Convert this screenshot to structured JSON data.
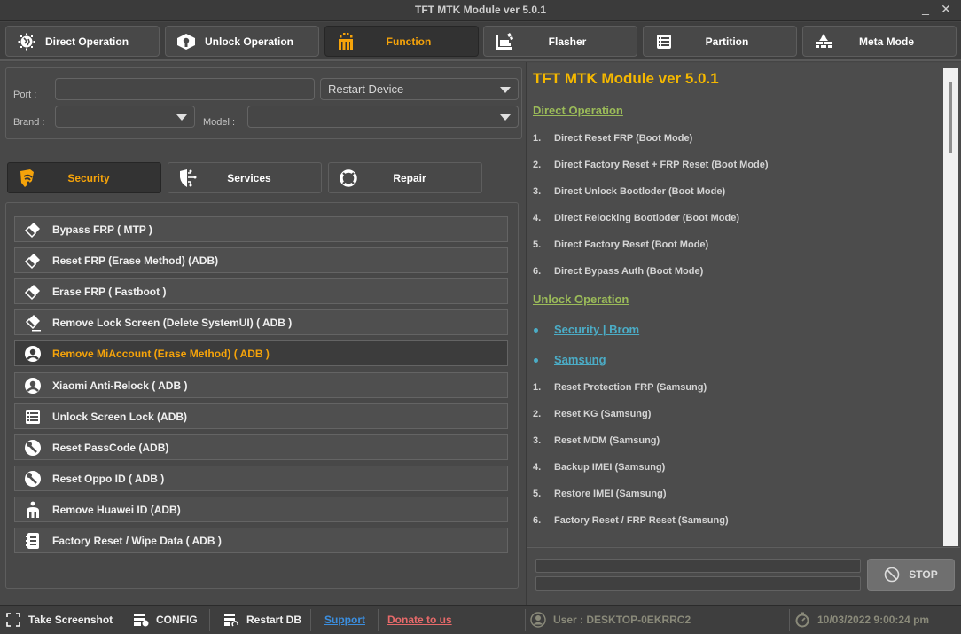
{
  "window": {
    "title": "TFT MTK Module ver 5.0.1",
    "minimize_icon": "minimize-icon",
    "close_icon": "close-icon"
  },
  "topnav": [
    {
      "label": "Direct Operation",
      "icon": "globe-gear-icon",
      "active": false
    },
    {
      "label": "Unlock Operation",
      "icon": "unlock-box-icon",
      "active": false
    },
    {
      "label": "Function",
      "icon": "gift-box-icon",
      "active": true
    },
    {
      "label": "Flasher",
      "icon": "flasher-icon",
      "active": false
    },
    {
      "label": "Partition",
      "icon": "list-icon",
      "active": false
    },
    {
      "label": "Meta Mode",
      "icon": "firewall-icon",
      "active": false
    }
  ],
  "device": {
    "port_label": "Port :",
    "port_value": "",
    "restart_select": "Restart Device",
    "brand_label": "Brand :",
    "brand_value": "",
    "model_label": "Model :",
    "model_value": ""
  },
  "subtabs": [
    {
      "label": "Security",
      "icon": "shield-wifi-icon",
      "active": true
    },
    {
      "label": "Services",
      "icon": "shield-circuit-icon",
      "active": false
    },
    {
      "label": "Repair",
      "icon": "lifebuoy-icon",
      "active": false
    }
  ],
  "functions": [
    {
      "label": "Bypass FRP ( MTP )",
      "icon": "eraser-icon",
      "active": false
    },
    {
      "label": "Reset FRP (Erase Method) (ADB)",
      "icon": "eraser-icon",
      "active": false
    },
    {
      "label": "Erase FRP ( Fastboot )",
      "icon": "eraser-icon",
      "active": false
    },
    {
      "label": "Remove Lock Screen (Delete SystemUI) ( ADB )",
      "icon": "eraser-line-icon",
      "active": false
    },
    {
      "label": "Remove MiAccount (Erase Method) ( ADB )",
      "icon": "user-circle-icon",
      "active": true
    },
    {
      "label": "Xiaomi Anti-Relock ( ADB )",
      "icon": "user-circle-icon",
      "active": false
    },
    {
      "label": "Unlock Screen Lock (ADB)",
      "icon": "list-icon",
      "active": false
    },
    {
      "label": "Reset PassCode (ADB)",
      "icon": "wrench-circle-icon",
      "active": false
    },
    {
      "label": "Reset Oppo ID ( ADB )",
      "icon": "wrench-circle-icon",
      "active": false
    },
    {
      "label": "Remove Huawei ID (ADB)",
      "icon": "person-m-icon",
      "active": false
    },
    {
      "label": "Factory Reset / Wipe Data ( ADB )",
      "icon": "notebook-icon",
      "active": false
    }
  ],
  "log": {
    "title": "TFT MTK Module ver 5.0.1",
    "sections": [
      {
        "heading": "Direct Operation",
        "items": [
          {
            "num": "1.",
            "text": "Direct Reset FRP (Boot Mode)"
          },
          {
            "num": "2.",
            "text": "Direct Factory Reset + FRP Reset (Boot Mode)"
          },
          {
            "num": "3.",
            "text": "Direct Unlock Bootloder (Boot Mode)"
          },
          {
            "num": "4.",
            "text": "Direct Relocking Bootloder (Boot Mode)"
          },
          {
            "num": "5.",
            "text": "Direct Factory Reset (Boot Mode)"
          },
          {
            "num": "6.",
            "text": "Direct Bypass Auth (Boot Mode)"
          }
        ]
      },
      {
        "heading": "Unlock Operation",
        "links": [
          "Security | Brom",
          "Samsung"
        ],
        "items": [
          {
            "num": "1.",
            "text": "Reset Protection FRP (Samsung)"
          },
          {
            "num": "2.",
            "text": "Reset KG (Samsung)"
          },
          {
            "num": "3.",
            "text": "Reset MDM (Samsung)"
          },
          {
            "num": "4.",
            "text": "Backup IMEI (Samsung)"
          },
          {
            "num": "5.",
            "text": "Restore IMEI (Samsung)"
          },
          {
            "num": "6.",
            "text": "Factory Reset / FRP Reset (Samsung)"
          }
        ]
      }
    ]
  },
  "progress": {
    "bar1": 0,
    "bar2": 0
  },
  "stop_button": {
    "label": "STOP",
    "icon": "ban-icon"
  },
  "statusbar": {
    "screenshot": "Take Screenshot",
    "config": "CONFIG",
    "restart_db": "Restart DB",
    "support": "Support",
    "donate": "Donate to us",
    "user": "User : DESKTOP-0EKRRC2",
    "datetime": "10/03/2022 9:00:24 pm"
  },
  "colors": {
    "accent": "#f5a30a",
    "log_title": "#f5b800",
    "log_heading": "#9bbb59",
    "log_link": "#4bacc6",
    "support_link": "#3b8fe0",
    "donate_link": "#e86a6a"
  }
}
